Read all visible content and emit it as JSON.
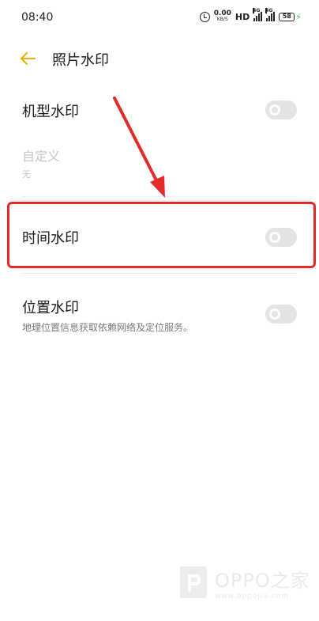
{
  "status_bar": {
    "time": "08:40",
    "net_speed_value": "0.00",
    "net_speed_unit": "KB/S",
    "hd": "HD",
    "signal_tag_1": "4G",
    "signal_tag_2": "4G",
    "battery": "58",
    "icons": [
      "alarm-icon",
      "signal-icon",
      "battery-icon",
      "charging-icon"
    ]
  },
  "header": {
    "back_icon": "arrow-left-icon",
    "title": "照片水印"
  },
  "settings": {
    "model_watermark": {
      "label": "机型水印",
      "enabled": false
    },
    "custom": {
      "label": "自定义",
      "value": "无",
      "disabled": true
    },
    "time_watermark": {
      "label": "时间水印",
      "enabled": false
    },
    "location_watermark": {
      "label": "位置水印",
      "description": "地理位置信息获取依赖网络及定位服务。",
      "enabled": false
    }
  },
  "annotation": {
    "color": "#e52a2a"
  },
  "watermark": {
    "brand": "OPPO之家",
    "url": "www.oppojia.com"
  },
  "colors": {
    "accent": "#e8b400",
    "switch_off": "#e4e4e4",
    "annotation": "#e52a2a"
  }
}
